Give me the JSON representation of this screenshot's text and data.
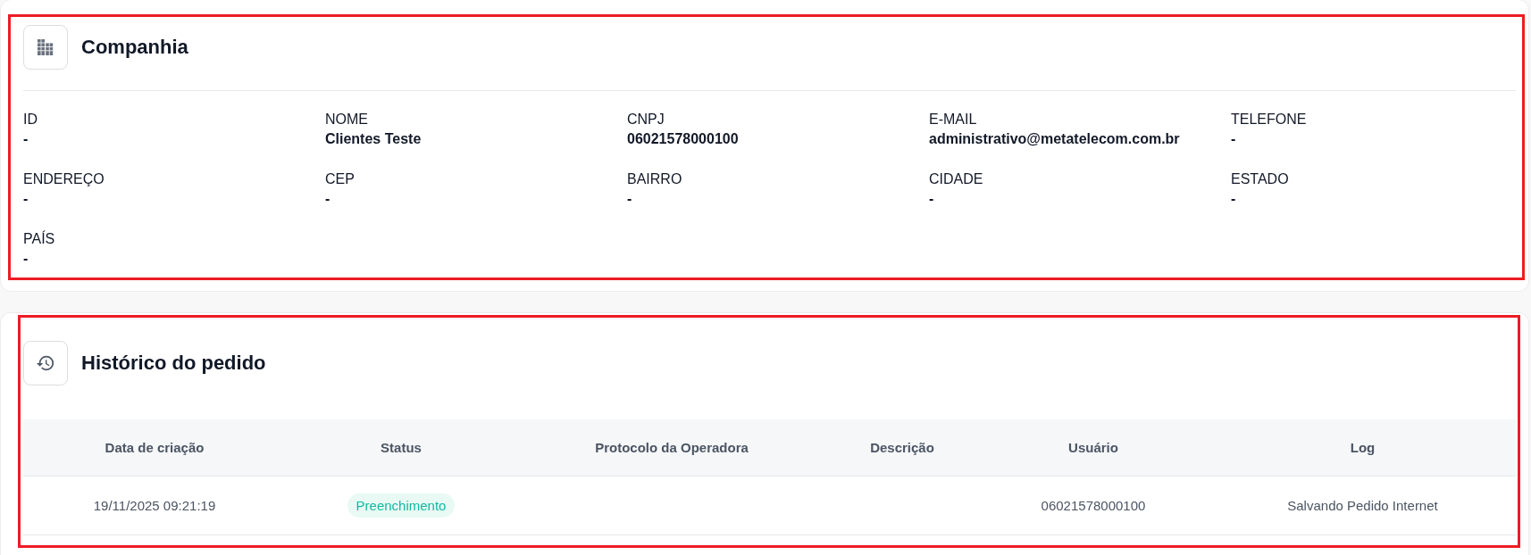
{
  "company": {
    "title": "Companhia",
    "fields": [
      {
        "label": "ID",
        "value": "-"
      },
      {
        "label": "NOME",
        "value": "Clientes Teste"
      },
      {
        "label": "CNPJ",
        "value": "06021578000100"
      },
      {
        "label": "E-MAIL",
        "value": "administrativo@metatelecom.com.br"
      },
      {
        "label": "TELEFONE",
        "value": "-"
      },
      {
        "label": "ENDEREÇO",
        "value": "-"
      },
      {
        "label": "CEP",
        "value": "-"
      },
      {
        "label": "BAIRRO",
        "value": "-"
      },
      {
        "label": "CIDADE",
        "value": "-"
      },
      {
        "label": "ESTADO",
        "value": "-"
      },
      {
        "label": "PAÍS",
        "value": "-"
      }
    ]
  },
  "order_history": {
    "title": "Histórico do pedido",
    "columns": [
      "Data de criação",
      "Status",
      "Protocolo da Operadora",
      "Descrição",
      "Usuário",
      "Log"
    ],
    "rows": [
      {
        "cells": [
          {
            "kind": "text",
            "text": "19/11/2025 09:21:19"
          },
          {
            "kind": "badge",
            "text": "Preenchimento"
          },
          {
            "kind": "empty"
          },
          {
            "kind": "empty"
          },
          {
            "kind": "text",
            "text": "06021578000100"
          },
          {
            "kind": "text",
            "text": "Salvando Pedido Internet"
          }
        ]
      }
    ]
  }
}
